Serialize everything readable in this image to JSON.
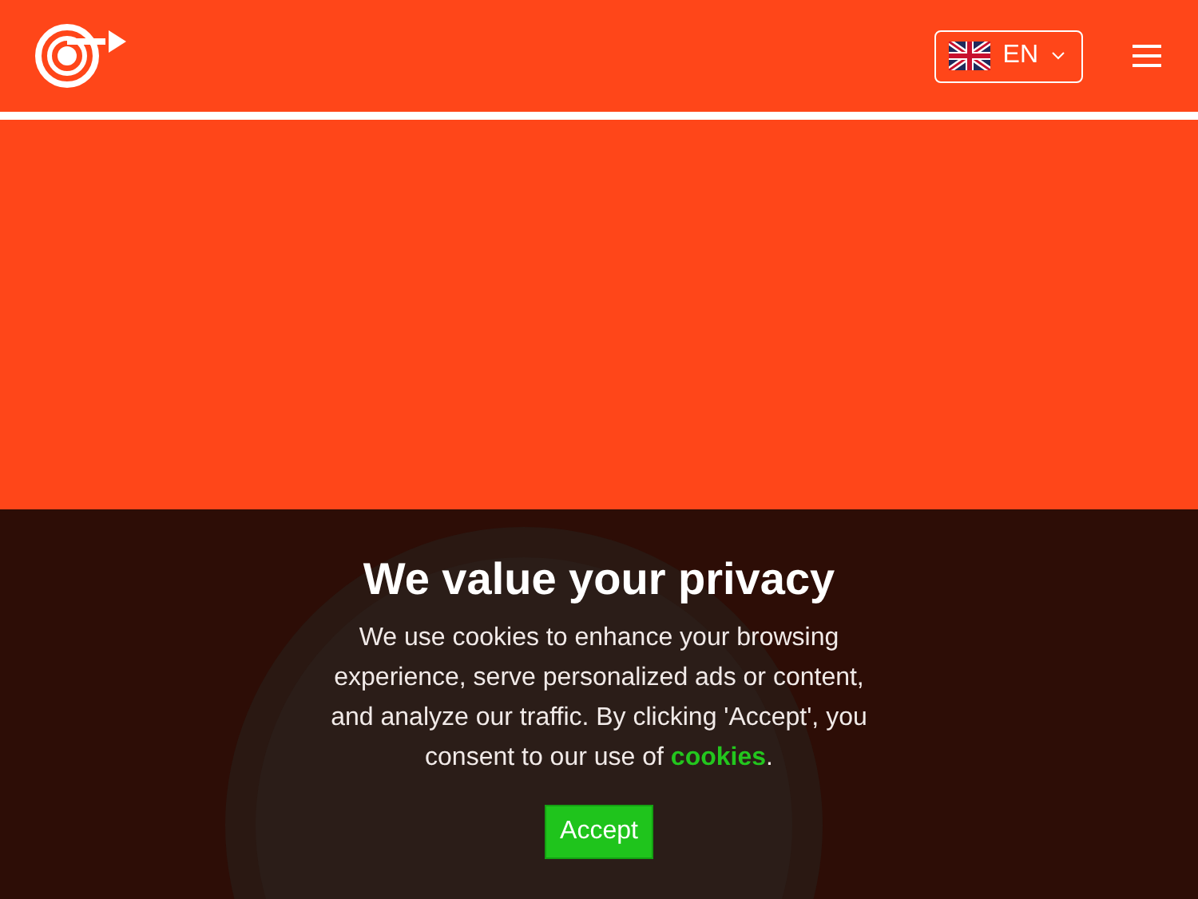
{
  "header": {
    "language": {
      "code": "EN"
    }
  },
  "consent": {
    "title": "We value your privacy",
    "text": "We use cookies to enhance your browsing experience, serve personalized ads or content, and analyze our traffic. By clicking 'Accept', you consent to our use of",
    "link": "cookies",
    "after": ".",
    "button": "Accept"
  }
}
